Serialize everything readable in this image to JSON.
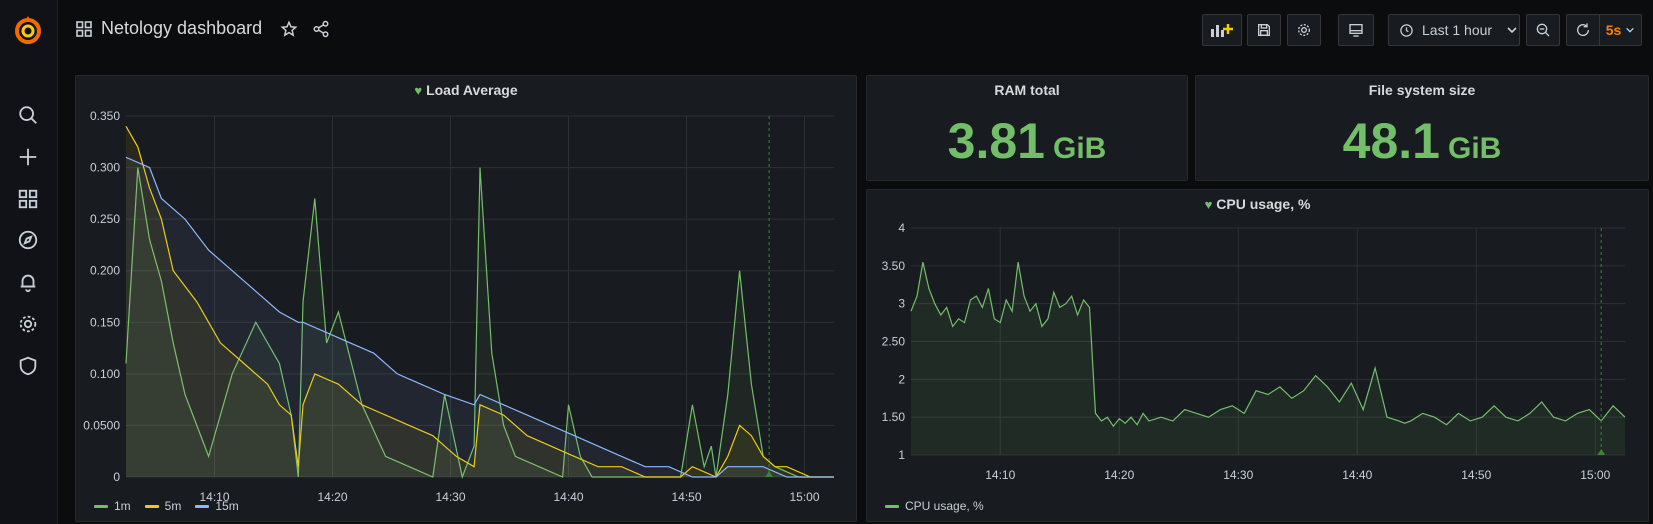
{
  "dashboard": {
    "title": "Netology dashboard"
  },
  "toolbar": {
    "time_range": "Last 1 hour",
    "refresh_interval": "5s"
  },
  "colors": {
    "accent": "#73bf69",
    "series_1m": "#73bf69",
    "series_5m": "#f2cc0c",
    "series_15m": "#8ab8ff",
    "refresh": "#ff7f00"
  },
  "icons": [
    "grafana-logo",
    "search-icon",
    "plus-icon",
    "dashboards-icon",
    "explore-icon",
    "bell-icon",
    "gear-icon",
    "shield-icon",
    "apps-icon",
    "star-icon",
    "share-icon",
    "add-panel-icon",
    "save-icon",
    "settings-icon",
    "tv-icon",
    "clock-icon",
    "chevron-down-icon",
    "zoom-out-icon",
    "refresh-icon"
  ],
  "panels": {
    "load": {
      "title": "Load Average"
    },
    "ram": {
      "title": "RAM total",
      "value": "3.81",
      "unit": "GiB"
    },
    "fs": {
      "title": "File system size",
      "value": "48.1",
      "unit": "GiB"
    },
    "cpu": {
      "title": "CPU usage, %"
    }
  },
  "chart_data": [
    {
      "type": "line",
      "title": "Load Average",
      "x_ticks": [
        "14:10",
        "14:20",
        "14:30",
        "14:40",
        "14:50",
        "15:00"
      ],
      "y_ticks": [
        "0",
        "0.0500",
        "0.100",
        "0.150",
        "0.200",
        "0.250",
        "0.300",
        "0.350"
      ],
      "ylim": [
        0,
        0.35
      ],
      "x_minutes": [
        0,
        60
      ],
      "legend": "bottom-left",
      "series": [
        {
          "name": "1m",
          "x": [
            0,
            1,
            2,
            3,
            4,
            5,
            6,
            7,
            9,
            11,
            13,
            14,
            14.6,
            15,
            16,
            17,
            18,
            20,
            22,
            24,
            26,
            27,
            28.5,
            29.5,
            30,
            31,
            32,
            33,
            35,
            37,
            37.5,
            38.5,
            39.5,
            41,
            43,
            45,
            47,
            48,
            49,
            49.6,
            50,
            51,
            52,
            53,
            54,
            55,
            57,
            60
          ],
          "y": [
            0.11,
            0.3,
            0.23,
            0.19,
            0.13,
            0.08,
            0.05,
            0.02,
            0.1,
            0.15,
            0.11,
            0.06,
            0.0,
            0.17,
            0.27,
            0.13,
            0.16,
            0.07,
            0.02,
            0.01,
            0.0,
            0.08,
            0.0,
            0.03,
            0.3,
            0.12,
            0.05,
            0.02,
            0.01,
            0.0,
            0.07,
            0.02,
            0.0,
            0.0,
            0.0,
            0.0,
            0.0,
            0.07,
            0.01,
            0.03,
            0.0,
            0.08,
            0.2,
            0.09,
            0.02,
            0.01,
            0.0,
            0.0
          ]
        },
        {
          "name": "5m",
          "x": [
            0,
            1,
            2,
            3,
            4,
            6,
            8,
            10,
            12,
            13,
            14,
            14.6,
            15,
            16,
            18,
            20,
            22,
            24,
            26,
            28,
            29.5,
            30,
            32,
            34,
            36,
            38,
            40,
            42,
            44,
            46,
            47,
            48,
            50,
            51,
            52,
            53,
            54,
            55,
            56,
            58,
            60
          ],
          "y": [
            0.34,
            0.32,
            0.28,
            0.25,
            0.2,
            0.17,
            0.13,
            0.11,
            0.09,
            0.07,
            0.06,
            0.01,
            0.07,
            0.1,
            0.09,
            0.07,
            0.06,
            0.05,
            0.04,
            0.02,
            0.01,
            0.07,
            0.06,
            0.04,
            0.03,
            0.02,
            0.01,
            0.01,
            0.0,
            0.0,
            0.0,
            0.01,
            0.0,
            0.02,
            0.05,
            0.04,
            0.02,
            0.01,
            0.01,
            0.0,
            0.0
          ]
        },
        {
          "name": "15m",
          "x": [
            0,
            2,
            3,
            5,
            7,
            9,
            11,
            13,
            14.6,
            15,
            17,
            19,
            21,
            23,
            25,
            27,
            29.5,
            30,
            32,
            34,
            36,
            38,
            40,
            42,
            44,
            46,
            48,
            50,
            51,
            52,
            54,
            56,
            60
          ],
          "y": [
            0.31,
            0.3,
            0.27,
            0.25,
            0.22,
            0.2,
            0.18,
            0.16,
            0.15,
            0.15,
            0.14,
            0.13,
            0.12,
            0.1,
            0.09,
            0.08,
            0.07,
            0.08,
            0.07,
            0.06,
            0.05,
            0.04,
            0.03,
            0.02,
            0.01,
            0.01,
            0.0,
            0.0,
            0.01,
            0.01,
            0.01,
            0.0,
            0.0
          ]
        }
      ]
    },
    {
      "type": "area",
      "title": "CPU usage, %",
      "x_ticks": [
        "14:10",
        "14:20",
        "14:30",
        "14:40",
        "14:50",
        "15:00"
      ],
      "y_ticks": [
        "1",
        "1.50",
        "2",
        "2.50",
        "3",
        "3.50",
        "4"
      ],
      "ylim": [
        1,
        4
      ],
      "x_minutes": [
        0,
        60
      ],
      "legend": "bottom-left",
      "series": [
        {
          "name": "CPU usage, %",
          "x": [
            0,
            0.5,
            1,
            1.5,
            2,
            2.5,
            3,
            3.5,
            4,
            4.5,
            5,
            5.5,
            6,
            6.5,
            7,
            7.5,
            8,
            8.5,
            9,
            9.5,
            10,
            10.5,
            11,
            11.5,
            12,
            12.5,
            13,
            13.5,
            14,
            14.5,
            15,
            15.5,
            16,
            16.5,
            17,
            17.5,
            18,
            18.5,
            19,
            19.5,
            20,
            21,
            22,
            23,
            24,
            25,
            26,
            27,
            28,
            29,
            30,
            31,
            32,
            33,
            34,
            35,
            36,
            37,
            38,
            39,
            40,
            41,
            41.5,
            42,
            43,
            44,
            45,
            46,
            47,
            48,
            49,
            50,
            51,
            52,
            53,
            54,
            55,
            56,
            57,
            58,
            59,
            60
          ],
          "y": [
            2.9,
            3.1,
            3.55,
            3.2,
            3.0,
            2.85,
            2.95,
            2.7,
            2.8,
            2.75,
            3.05,
            3.1,
            2.95,
            3.2,
            2.8,
            2.75,
            3.05,
            2.9,
            3.55,
            3.1,
            2.9,
            3.0,
            2.7,
            2.8,
            3.15,
            2.95,
            3.0,
            3.1,
            2.85,
            3.05,
            2.95,
            1.55,
            1.45,
            1.5,
            1.38,
            1.48,
            1.42,
            1.5,
            1.4,
            1.55,
            1.45,
            1.5,
            1.45,
            1.6,
            1.55,
            1.5,
            1.6,
            1.65,
            1.55,
            1.85,
            1.8,
            1.9,
            1.75,
            1.85,
            2.05,
            1.9,
            1.7,
            1.95,
            1.6,
            2.15,
            1.5,
            1.45,
            1.42,
            1.45,
            1.55,
            1.5,
            1.4,
            1.55,
            1.45,
            1.5,
            1.65,
            1.5,
            1.45,
            1.55,
            1.7,
            1.5,
            1.45,
            1.55,
            1.6,
            1.45,
            1.65,
            1.5
          ]
        }
      ]
    }
  ]
}
